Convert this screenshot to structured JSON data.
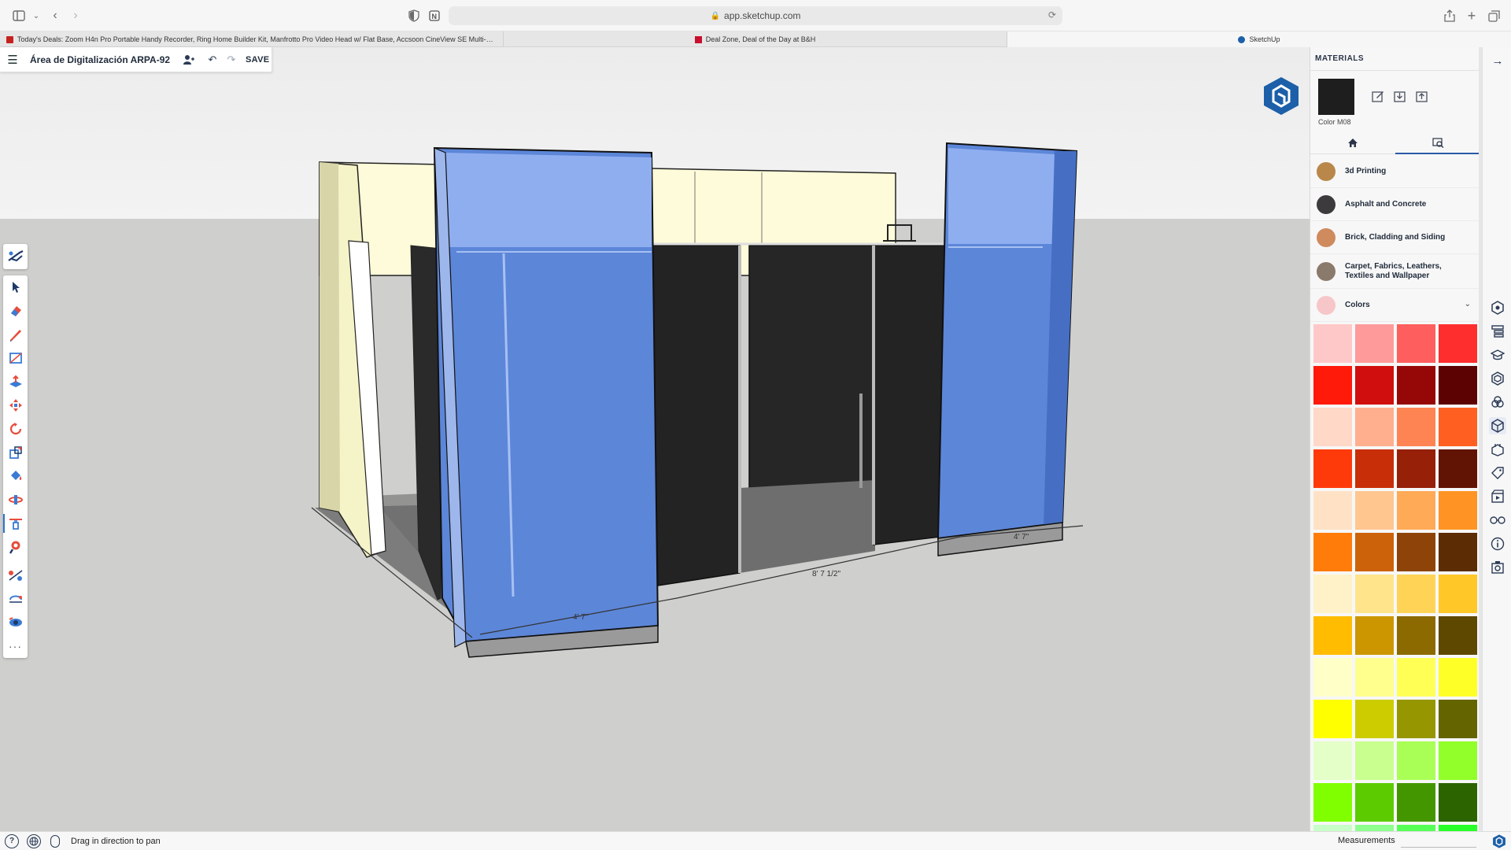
{
  "browser": {
    "url": "app.sketchup.com",
    "tabs": [
      {
        "label": "Today's Deals: Zoom H4n Pro Portable Handy Recorder, Ring Home Builder Kit, Manfrotto Pro Video Head w/ Flat Base, Accsoon CineView SE Multi-Spe...",
        "favicon_color": "#c5221f"
      },
      {
        "label": "Deal Zone, Deal of the Day at B&H",
        "favicon_color": "#c8102e"
      },
      {
        "label": "SketchUp",
        "favicon_color": "#1d5fa8"
      }
    ]
  },
  "title_panel": {
    "title": "Área de Digitalización ARPA-92",
    "save_label": "SAVE"
  },
  "materials": {
    "header": "MATERIALS",
    "current_name": "Color M08",
    "current_color": "#1e1e1e",
    "categories": [
      {
        "label": "3d Printing",
        "color": "#b9874a"
      },
      {
        "label": "Asphalt and Concrete",
        "color": "#3c3a3c"
      },
      {
        "label": "Brick, Cladding and Siding",
        "color": "#cf8a5e"
      },
      {
        "label": "Carpet, Fabrics, Leathers, Textiles and Wallpaper",
        "color": "#8a7a6c"
      },
      {
        "label": "Colors",
        "color": "#f7c6c8"
      }
    ],
    "swatches": [
      "#ffc8c8",
      "#ff9a9a",
      "#ff5e5e",
      "#ff2e2e",
      "#ff1a0a",
      "#d00e0e",
      "#960808",
      "#5c0202",
      "#ffd8c8",
      "#ffae8e",
      "#ff8454",
      "#ff6022",
      "#ff3a0a",
      "#c82e08",
      "#962008",
      "#621404",
      "#ffe2c6",
      "#ffc690",
      "#ffaa56",
      "#ff9424",
      "#ff7c0a",
      "#cc620a",
      "#8e4408",
      "#5c2c04",
      "#fff2c8",
      "#ffe48c",
      "#ffd456",
      "#ffc828",
      "#ffbc00",
      "#cc9600",
      "#8c6a00",
      "#5e4800",
      "#ffffc8",
      "#ffff8e",
      "#ffff56",
      "#ffff28",
      "#ffff00",
      "#cccc00",
      "#969600",
      "#646400",
      "#e4ffc8",
      "#c8ff8e",
      "#aaff56",
      "#92ff2a",
      "#80ff00",
      "#5ccc00",
      "#449600",
      "#2c6400",
      "#c8ffc8",
      "#8eff8e",
      "#56ff56",
      "#28ff28"
    ]
  },
  "scene": {
    "dimensions": [
      "4' 7\"",
      "8' 7 1/2\"",
      "4' 7\""
    ]
  },
  "status": {
    "hint": "Drag in direction to pan",
    "measurements_label": "Measurements"
  },
  "icons": {
    "toolbar": [
      "search-icon",
      "select-icon",
      "eraser-icon",
      "pencil-icon",
      "rectangle-icon",
      "push-pull-icon",
      "move-icon",
      "rotate-icon",
      "scale-icon",
      "paint-bucket-icon",
      "orbit-icon",
      "pan-icon",
      "zoom-icon",
      "tape-measure-icon",
      "section-icon",
      "walk-icon",
      "more-icon"
    ],
    "right_strip": [
      "entity-info-icon",
      "outliner-icon",
      "instructor-icon",
      "components-icon",
      "materials-icon",
      "styles-icon",
      "scenes-icon",
      "tags-icon",
      "animation-icon",
      "display-icon",
      "info-icon",
      "export-icon"
    ]
  }
}
